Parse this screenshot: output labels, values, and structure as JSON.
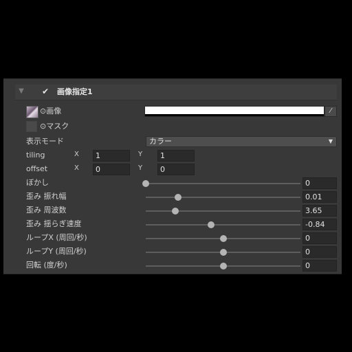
{
  "header": {
    "collapse_arrow": "▼",
    "check": "✔",
    "title": "画像指定1"
  },
  "image_field": {
    "label": "⊙画像",
    "picker_icon": "eyedropper-icon",
    "color": "#ffffff"
  },
  "mask_field": {
    "label": "⊙マスク"
  },
  "display_mode": {
    "label": "表示モード",
    "value": "カラー",
    "arrow": "▼"
  },
  "tiling": {
    "label": "tiling",
    "x_label": "X",
    "x": "1",
    "y_label": "Y",
    "y": "1"
  },
  "offset": {
    "label": "offset",
    "x_label": "X",
    "x": "0",
    "y_label": "Y",
    "y": "0"
  },
  "sliders": [
    {
      "label": "ぼかし",
      "value": "0",
      "fraction": 0.0
    },
    {
      "label": "歪み 振れ幅",
      "value": "0.01",
      "fraction": 0.21
    },
    {
      "label": "歪み 周波数",
      "value": "3.65",
      "fraction": 0.19
    },
    {
      "label": "歪み 揺らぎ速度",
      "value": "-0.84",
      "fraction": 0.42
    },
    {
      "label": "ループX (周回/秒)",
      "value": "0",
      "fraction": 0.5
    },
    {
      "label": "ループY (周回/秒)",
      "value": "0",
      "fraction": 0.5
    },
    {
      "label": "回転 (度/秒)",
      "value": "0",
      "fraction": 0.5
    }
  ]
}
